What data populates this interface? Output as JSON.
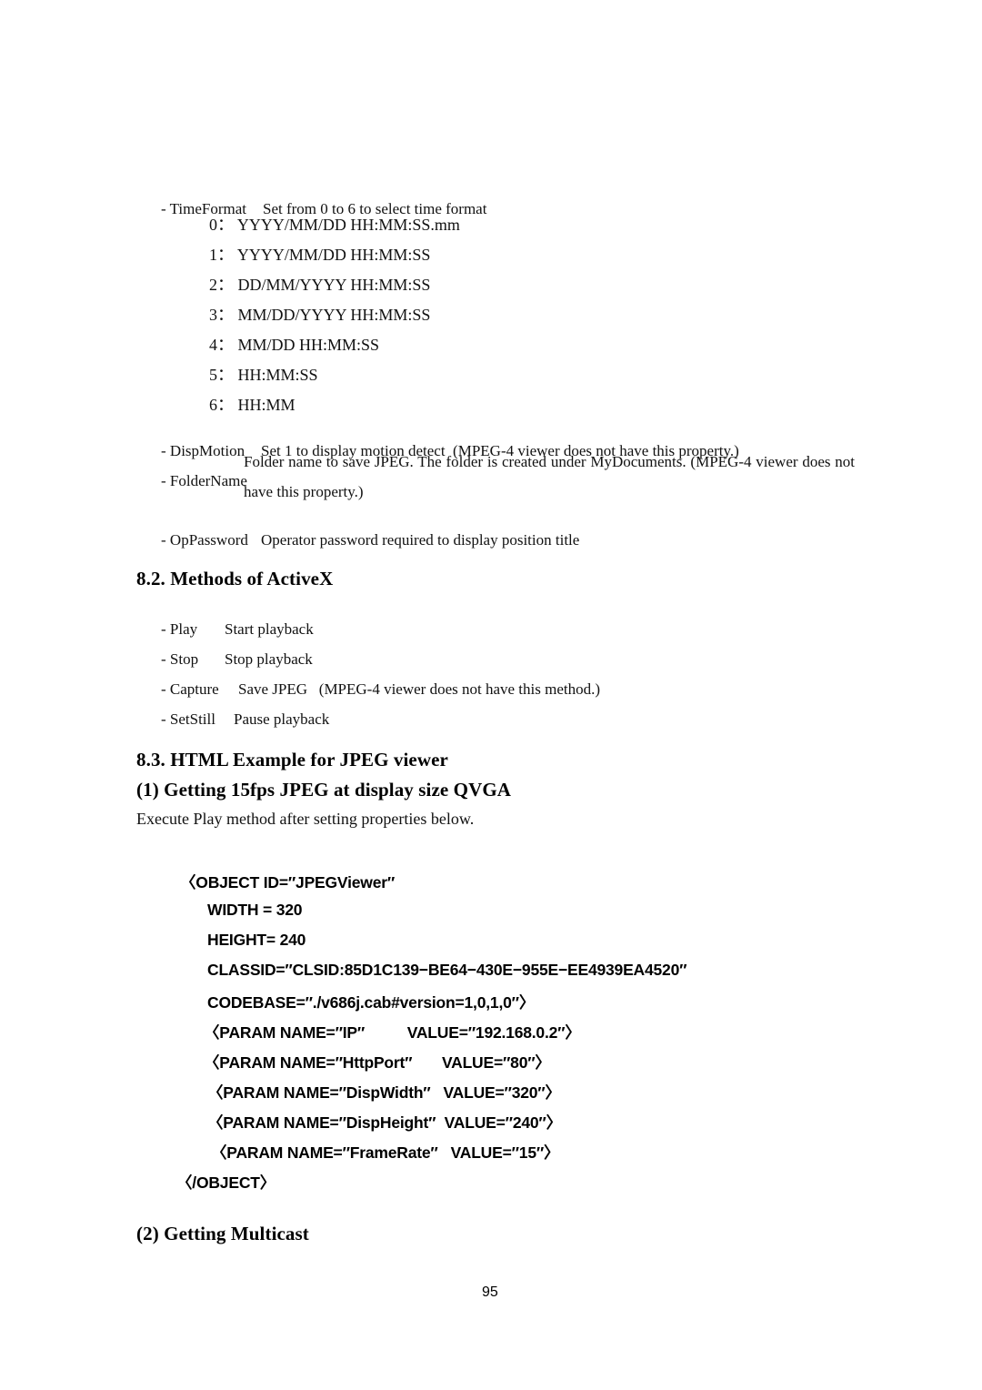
{
  "document": {
    "page_number": "95"
  },
  "properties_section": {
    "time_format": {
      "label": "- TimeFormat",
      "description": "Set from 0 to 6 to select time format",
      "options": [
        "0： YYYY/MM/DD HH:MM:SS.mm",
        "1： YYYY/MM/DD HH:MM:SS",
        "2： DD/MM/YYYY HH:MM:SS",
        "3： MM/DD/YYYY HH:MM:SS",
        "4： MM/DD HH:MM:SS",
        "5： HH:MM:SS",
        "6： HH:MM"
      ]
    },
    "items": [
      {
        "label": "- DispMotion",
        "description": "Set 1 to display motion detect  (MPEG-4 viewer does not have this property.)"
      },
      {
        "label": "- FolderName",
        "description": "Folder name to save JPEG. The folder is created under MyDocuments.  (MPEG-4 viewer does not have this property.)"
      },
      {
        "label": "- OpPassword",
        "description": "Operator password required to display position title"
      }
    ]
  },
  "methods_section": {
    "heading": "8.2. Methods of ActiveX",
    "items": [
      {
        "label": "- Play",
        "description": "Start playback"
      },
      {
        "label": "- Stop",
        "description": "Stop playback"
      },
      {
        "label": "- Capture",
        "description": "Save JPEG   (MPEG-4 viewer does not have this method.)"
      },
      {
        "label": "- SetStill",
        "description": "Pause playback"
      }
    ]
  },
  "html_example_section": {
    "heading": "8.3. HTML Example for JPEG viewer",
    "subheading": "(1) Getting 15fps JPEG at display size QVGA",
    "intro": "Execute Play method after setting properties below.",
    "code_lines": [
      "〈OBJECT ID=″JPEGViewer″",
      "WIDTH = 320",
      "HEIGHT= 240",
      "CLASSID=″CLSID:85D1C139−BE64−430E−955E−EE4939EA4520″",
      "CODEBASE=″./v686j.cab#version=1,0,1,0″〉",
      "〈PARAM NAME=″IP″          VALUE=″192.168.0.2″〉",
      "〈PARAM NAME=″HttpPort″       VALUE=″80″〉",
      "〈PARAM NAME=″DispWidth″   VALUE=″320″〉",
      "〈PARAM NAME=″DispHeight″  VALUE=″240″〉",
      "〈PARAM NAME=″FrameRate″   VALUE=″15″〉",
      "〈/OBJECT〉"
    ]
  },
  "multicast_section": {
    "subheading": "(2) Getting Multicast"
  }
}
